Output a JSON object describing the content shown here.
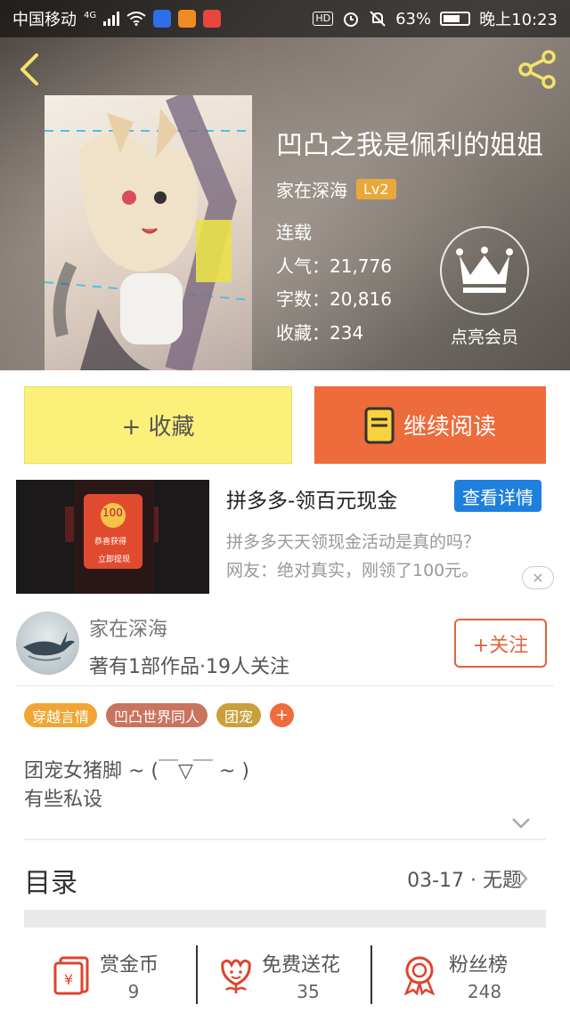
{
  "status_bar": {
    "carrier": "中国移动",
    "network": "4G",
    "battery": "63%",
    "time": "晚上10:23"
  },
  "book": {
    "title": "凹凸之我是佩利的姐姐",
    "author": "家在深海",
    "level": "Lv2",
    "status": "连载",
    "popularity": "人气：21,776",
    "word_count": "字数：20,816",
    "favorites": "收藏：234",
    "vip_label": "点亮会员"
  },
  "actions": {
    "collect_label": "+ 收藏",
    "read_label": "继续阅读"
  },
  "ad": {
    "title": "拼多多-领百元现金",
    "button": "查看详情",
    "desc_line1": "拼多多天天领现金活动是真的吗？",
    "desc_line2": "网友：绝对真实，刚领了100元。",
    "close": "✕",
    "img_amount": "100",
    "img_caption": "恭喜获得",
    "img_sub": "立即提现"
  },
  "author_card": {
    "name": "家在深海",
    "stats": "著有1部作品·19人关注",
    "follow_label": "+关注"
  },
  "tags": [
    {
      "label": "穿越言情",
      "color": "#f0a534"
    },
    {
      "label": "凹凸世界同人",
      "color": "#c9745f"
    },
    {
      "label": "团宠",
      "color": "#c9a03c"
    }
  ],
  "tag_add": "+",
  "summary": {
    "line1": "团宠女猪脚 ~ (￣▽￣ ~ )",
    "line2": "有些私设"
  },
  "toc": {
    "label": "目录",
    "latest": "03-17 · 无题"
  },
  "bottom_stats": [
    {
      "label": "赏金币",
      "value": "9"
    },
    {
      "label": "免费送花",
      "value": "35"
    },
    {
      "label": "粉丝榜",
      "value": "248"
    }
  ],
  "colors": {
    "accent": "#ee6b3b",
    "collect_bg": "#fbf07a",
    "ad_button": "#1f7fde",
    "icon_red": "#e0432c"
  }
}
